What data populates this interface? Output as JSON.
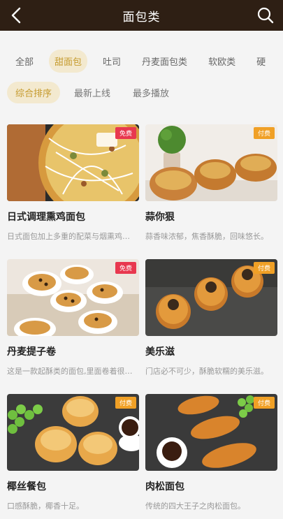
{
  "header": {
    "title": "面包类",
    "back_icon": "back-chevron-icon",
    "search_icon": "search-icon"
  },
  "categories": [
    "全部",
    "甜面包",
    "吐司",
    "丹麦面包类",
    "软欧类",
    "硬"
  ],
  "active_category": "甜面包",
  "sort_options": [
    "综合排序",
    "最新上线",
    "最多播放"
  ],
  "active_sort": "综合排序",
  "items": [
    {
      "name": "日式调理熏鸡面包",
      "desc": "日式面包加上多重的配菜与烟熏鸡肉。",
      "tag": "免费"
    },
    {
      "name": "蒜你狠",
      "desc": "蒜香味浓郁，焦香酥脆，回味悠长。",
      "tag": "付费"
    },
    {
      "name": "丹麦提子卷",
      "desc": "这是一款起酥类的面包,里面卷着很多提子。",
      "tag": "免费"
    },
    {
      "name": "美乐滋",
      "desc": "门店必不可少，酥脆软糯的美乐滋。",
      "tag": "付费"
    },
    {
      "name": "椰丝餐包",
      "desc": "口感酥脆，椰香十足。",
      "tag": "付费"
    },
    {
      "name": "肉松面包",
      "desc": "传统的四大王子之肉松面包。",
      "tag": "付费"
    }
  ],
  "colors": {
    "header_bg": "#2e1f14",
    "accent": "#c59a2c",
    "free_tag": "#e8384f",
    "paid_tag": "#f0a026"
  }
}
